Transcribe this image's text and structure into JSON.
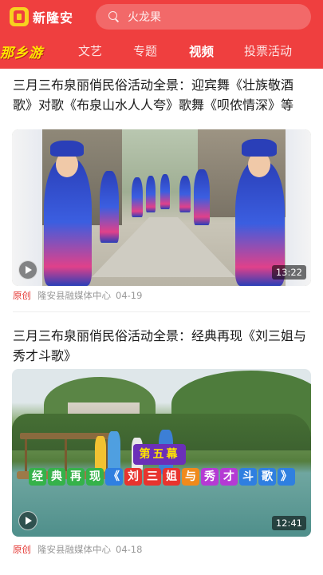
{
  "app": {
    "brand_name": "新隆安",
    "search_placeholder": "火龙果"
  },
  "tabs": [
    {
      "label": "那乡游",
      "special": true
    },
    {
      "label": "文艺",
      "active": false
    },
    {
      "label": "专题",
      "active": false
    },
    {
      "label": "视频",
      "active": true
    },
    {
      "label": "投票活动",
      "active": false
    }
  ],
  "feed": [
    {
      "title": "三月三布泉丽俏民俗活动全景：迎宾舞《壮族敬酒歌》对歌《布泉山水人人夸》歌舞《呗侬情深》等",
      "duration": "13:22",
      "tag": "原创",
      "source": "隆安县融媒体中心",
      "date": "04-19"
    },
    {
      "title": "三月三布泉丽俏民俗活动全景：经典再现《刘三姐与秀才斗歌》",
      "duration": "12:41",
      "tag": "原创",
      "source": "隆安县融媒体中心",
      "date": "04-18",
      "overlay_act": "第五幕",
      "overlay_banner": [
        "经",
        "典",
        "再",
        "现",
        "《",
        "刘",
        "三",
        "姐",
        "与",
        "秀",
        "才",
        "斗",
        "歌",
        "》"
      ]
    }
  ],
  "colors": {
    "header": "#ef3f3f",
    "accent": "#e53935",
    "special_tab": "#ffe500"
  }
}
